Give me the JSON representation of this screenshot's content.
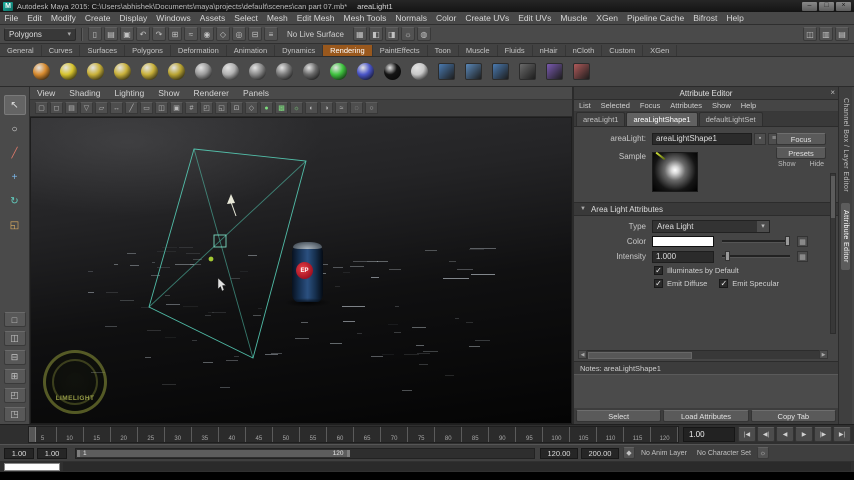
{
  "colors": {
    "light_wireframe": "#56cdb6",
    "shelf_active_tab": "#99581d",
    "can_blue": "#2b5080",
    "can_red": "#c01828",
    "watermark_green": "#a6ad4e"
  },
  "icons": {
    "maya_logo": "M",
    "dropdown_arrow": "▾",
    "section_collapse": "▼",
    "check": "✓",
    "close": "×",
    "scroll_left": "◀",
    "scroll_right": "▶",
    "checker_map": "▦",
    "key": "◆",
    "gear": "☼",
    "pin": "▪",
    "list": "≡"
  },
  "window": {
    "title": "Autodesk Maya 2015: C:\\Users\\abhishek\\Documents\\maya\\projects\\default\\scenes\\can part 07.mb*",
    "document": "areaLight1",
    "minimize": "–",
    "maximize": "□",
    "close": "×"
  },
  "menubar": [
    "File",
    "Edit",
    "Modify",
    "Create",
    "Display",
    "Windows",
    "Assets",
    "Select",
    "Mesh",
    "Edit Mesh",
    "Mesh Tools",
    "Normals",
    "Color",
    "Create UVs",
    "Edit UVs",
    "Muscle",
    "XGen",
    "Pipeline Cache",
    "Bifrost",
    "Help"
  ],
  "statusline": {
    "mode": "Polygons",
    "live_surface": "No Live Surface",
    "icons_a": [
      {
        "name": "new-scene-icon",
        "glyph": "▯"
      },
      {
        "name": "open-scene-icon",
        "glyph": "▤"
      },
      {
        "name": "save-scene-icon",
        "glyph": "▣"
      },
      {
        "name": "undo-icon",
        "glyph": "↶"
      },
      {
        "name": "redo-icon",
        "glyph": "↷"
      },
      {
        "name": "snap-to-grid-icon",
        "glyph": "⊞"
      },
      {
        "name": "snap-to-curve-icon",
        "glyph": "≈"
      },
      {
        "name": "snap-to-point-icon",
        "glyph": "◉"
      },
      {
        "name": "snap-to-plane-icon",
        "glyph": "◇"
      },
      {
        "name": "make-object-live-icon",
        "glyph": "◎"
      },
      {
        "name": "construction-history-icon",
        "glyph": "⊟"
      },
      {
        "name": "select-by-hierarchy-icon",
        "glyph": "≡"
      }
    ],
    "icons_b": [
      {
        "name": "render-view-icon",
        "glyph": "▦"
      },
      {
        "name": "render-current-frame-icon",
        "glyph": "◧"
      },
      {
        "name": "ipr-render-icon",
        "glyph": "◨"
      },
      {
        "name": "render-settings-icon",
        "glyph": "☼"
      },
      {
        "name": "hypershade-icon",
        "glyph": "◍"
      }
    ],
    "icons_c": [
      {
        "name": "show-modeling-toolkit-icon",
        "glyph": "◫"
      },
      {
        "name": "show-attribute-editor-icon",
        "glyph": "▥"
      },
      {
        "name": "show-channel-box-icon",
        "glyph": "▤"
      }
    ]
  },
  "shelf": {
    "tabs": [
      "General",
      "Curves",
      "Surfaces",
      "Polygons",
      "Deformation",
      "Animation",
      "Dynamics",
      "Rendering",
      "PaintEffects",
      "Toon",
      "Muscle",
      "Fluids",
      "nHair",
      "nCloth",
      "Custom",
      "XGen"
    ],
    "active": "Rendering",
    "icons": [
      {
        "name": "shelf-ambient-light",
        "color": "#d78a2e",
        "cls": "ball"
      },
      {
        "name": "shelf-directional-light",
        "color": "#d7c42e",
        "cls": "ball"
      },
      {
        "name": "shelf-point-light",
        "color": "#c9b13a",
        "cls": "ball"
      },
      {
        "name": "shelf-spot-light",
        "color": "#c9b13a",
        "cls": "ball"
      },
      {
        "name": "shelf-area-light",
        "color": "#c9b13a",
        "cls": "ball"
      },
      {
        "name": "shelf-volume-light",
        "color": "#b9a433",
        "cls": "ball"
      },
      {
        "name": "shelf-anisotropic-material",
        "color": "#9a9a9a",
        "cls": "ball"
      },
      {
        "name": "shelf-blinn-material",
        "color": "#b0b0b0",
        "cls": "ball"
      },
      {
        "name": "shelf-lambert-material",
        "color": "#8a8a8a",
        "cls": "ball"
      },
      {
        "name": "shelf-phong-material",
        "color": "#7a7a7a",
        "cls": "ball"
      },
      {
        "name": "shelf-layered-shader",
        "color": "#6a6a6a",
        "cls": "ball"
      },
      {
        "name": "shelf-ramp-shader",
        "color": "#3fc33f",
        "cls": "ball"
      },
      {
        "name": "shelf-ocean-shader",
        "color": "#4a55c8",
        "cls": "ball"
      },
      {
        "name": "shelf-black-hole",
        "color": "#141414",
        "cls": "ball"
      },
      {
        "name": "shelf-surface-shader",
        "color": "#c8c8c8",
        "cls": "ball"
      },
      {
        "name": "shelf-render-view",
        "color": "#4a7ab0",
        "cls": "flat"
      },
      {
        "name": "shelf-render-current-frame",
        "color": "#5a88b8",
        "cls": "flat"
      },
      {
        "name": "shelf-ipr-render",
        "color": "#4a7ab0",
        "cls": "flat"
      },
      {
        "name": "shelf-render-settings",
        "color": "#6a6a6a",
        "cls": "flat"
      },
      {
        "name": "shelf-hypershade",
        "color": "#7a5ab0",
        "cls": "flat"
      },
      {
        "name": "shelf-light-linking",
        "color": "#b05a5a",
        "cls": "flat"
      }
    ]
  },
  "toolbox": {
    "tools": [
      {
        "name": "select-tool",
        "glyph": "↖",
        "cls": "sel"
      },
      {
        "name": "lasso-tool",
        "glyph": "○"
      },
      {
        "name": "paint-select-tool",
        "glyph": "╱",
        "cls": "red"
      },
      {
        "name": "move-tool",
        "glyph": "+",
        "cls": "blue"
      },
      {
        "name": "rotate-tool",
        "glyph": "↻",
        "cls": "teal"
      },
      {
        "name": "scale-tool",
        "glyph": "◱",
        "cls": "orange"
      }
    ],
    "layouts": [
      {
        "name": "single-pane-layout-button",
        "glyph": "□"
      },
      {
        "name": "two-pane-side-layout-button",
        "glyph": "◫"
      },
      {
        "name": "two-pane-stacked-layout-button",
        "glyph": "⊟"
      },
      {
        "name": "four-pane-layout-button",
        "glyph": "⊞"
      },
      {
        "name": "three-pane-split-layout-button",
        "glyph": "◰"
      },
      {
        "name": "outliner-persp-layout-button",
        "glyph": "◳"
      }
    ]
  },
  "viewport": {
    "menu": [
      "View",
      "Shading",
      "Lighting",
      "Show",
      "Renderer",
      "Panels"
    ],
    "toolbar_icons": [
      {
        "name": "select-camera-icon",
        "glyph": "▢"
      },
      {
        "name": "lock-camera-icon",
        "glyph": "◻"
      },
      {
        "name": "camera-attributes-icon",
        "glyph": "▤"
      },
      {
        "name": "bookmarks-icon",
        "glyph": "▽"
      },
      {
        "name": "image-plane-icon",
        "glyph": "▱"
      },
      {
        "name": "two-d-pan-zoom-icon",
        "glyph": "↔"
      },
      {
        "name": "grease-pencil-icon",
        "glyph": "╱"
      },
      {
        "name": "film-gate-icon",
        "glyph": "▭"
      },
      {
        "name": "resolution-gate-icon",
        "glyph": "◫"
      },
      {
        "name": "gate-mask-icon",
        "glyph": "▣"
      },
      {
        "name": "field-chart-icon",
        "glyph": "#"
      },
      {
        "name": "safe-action-icon",
        "glyph": "◰"
      },
      {
        "name": "safe-title-icon",
        "glyph": "◱"
      },
      {
        "name": "frame-all-icon",
        "glyph": "⊡"
      },
      {
        "name": "wireframe-icon",
        "glyph": "◇"
      },
      {
        "name": "smooth-shade-icon",
        "glyph": "●",
        "cls": "green"
      },
      {
        "name": "textured-icon",
        "glyph": "▩",
        "cls": "green"
      },
      {
        "name": "use-all-lights-icon",
        "glyph": "☼",
        "cls": "green"
      },
      {
        "name": "shadows-icon",
        "glyph": "◐"
      },
      {
        "name": "ambient-occlusion-icon",
        "glyph": "◑"
      },
      {
        "name": "motion-blur-icon",
        "glyph": "≈"
      },
      {
        "name": "x-ray-icon",
        "glyph": "◌"
      },
      {
        "name": "isolate-select-icon",
        "glyph": "○"
      }
    ],
    "can_label": "EP",
    "watermark": "LIMELIGHT"
  },
  "attribute_editor": {
    "title": "Attribute Editor",
    "menu": [
      "List",
      "Selected",
      "Focus",
      "Attributes",
      "Show",
      "Help"
    ],
    "tabs": [
      "areaLight1",
      "areaLightShape1",
      "defaultLightSet"
    ],
    "active_tab": "areaLightShape1",
    "name_label": "areaLight:",
    "name_value": "areaLightShape1",
    "focus_button": "Focus",
    "presets_button": "Presets",
    "show_label": "Show",
    "hide_label": "Hide",
    "sample_label": "Sample",
    "section_area_light": "Area Light Attributes",
    "type_label": "Type",
    "type_value": "Area Light",
    "color_label": "Color",
    "intensity_label": "Intensity",
    "intensity_value": "1.000",
    "illuminates_by_default": "Illuminates by Default",
    "emit_diffuse": "Emit Diffuse",
    "emit_specular": "Emit Specular",
    "notes": "Notes: areaLightShape1",
    "footer": [
      "Select",
      "Load Attributes",
      "Copy Tab"
    ]
  },
  "right_tabs": [
    {
      "name": "channel-box-tab",
      "label": "Channel Box / Layer Editor"
    },
    {
      "name": "attribute-editor-tab",
      "label": "Attribute Editor"
    }
  ],
  "timeline": {
    "labels": [
      "5",
      "10",
      "15",
      "20",
      "25",
      "30",
      "35",
      "40",
      "45",
      "50",
      "55",
      "60",
      "65",
      "70",
      "75",
      "80",
      "85",
      "90",
      "95",
      "100",
      "105",
      "110",
      "115",
      "120"
    ],
    "current_time": "1.00",
    "playback": [
      {
        "name": "go-to-start-button",
        "glyph": "|◀"
      },
      {
        "name": "step-back-frame-button",
        "glyph": "◀|"
      },
      {
        "name": "play-backwards-button",
        "glyph": "◀"
      },
      {
        "name": "play-forwards-button",
        "glyph": "▶"
      },
      {
        "name": "step-forward-frame-button",
        "glyph": "|▶"
      },
      {
        "name": "go-to-end-button",
        "glyph": "▶|"
      }
    ]
  },
  "range_slider": {
    "anim_start": "1.00",
    "playback_start": "1.00",
    "range_start_label": "1",
    "range_end_label": "120",
    "playback_end": "120.00",
    "anim_end": "200.00",
    "anim_layer": "No Anim Layer",
    "character_set": "No Character Set"
  },
  "command_line": {
    "value": ""
  }
}
